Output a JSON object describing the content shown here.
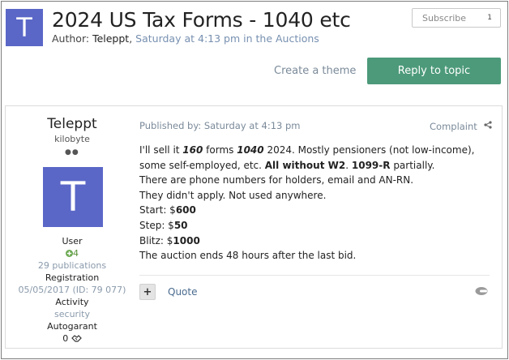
{
  "topic": {
    "avatar_letter": "T",
    "title": "2024 US Tax Forms - 1040 etc",
    "author_label": "Author: ",
    "author_name": "Teleppt",
    "author_sep": ", ",
    "posted_when": "Saturday at 4:13 pm in the Auctions"
  },
  "subscribe": {
    "label": "Subscribe",
    "count": "1"
  },
  "actions": {
    "create_theme": "Create a theme",
    "reply": "Reply to topic"
  },
  "post": {
    "user": {
      "name": "Teleppt",
      "rank": "kilobyte",
      "rank_dots": "●●",
      "avatar_letter": "T",
      "role": "User",
      "reputation": "4",
      "publications": "29 publications",
      "registration_label": "Registration",
      "registration_value": "05/05/2017 (ID: 79 077)",
      "activity_label": "Activity",
      "activity_value": "security",
      "autogarant_label": "Autogarant",
      "autogarant_value": "0"
    },
    "published": "Published by: Saturday at 4:13 pm",
    "complaint": "Complaint",
    "lines": {
      "l1a": "I'll sell it ",
      "l1b": "160",
      "l1c": " forms ",
      "l1d": "1040",
      "l1e": " 2024. Mostly pensioners (not low-income),",
      "l2a": "some self-employed, etc. ",
      "l2b": "All without W2",
      "l2c": ". ",
      "l2d": "1099-R",
      "l2e": " partially.",
      "l3": "There are phone numbers for holders, email and AN-RN.",
      "l4": "They didn't apply. Not used anywhere.",
      "l5a": "Start: $",
      "l5b": "600",
      "l6a": "Step: $",
      "l6b": "50",
      "l7a": "Blitz: $",
      "l7b": "1000",
      "l8": "The auction ends 48 hours after the last bid."
    },
    "plus_label": "+",
    "quote": "Quote"
  },
  "colors": {
    "accent": "#4c9a7a",
    "avatar": "#5a67c7",
    "muted": "#7a8a99"
  }
}
